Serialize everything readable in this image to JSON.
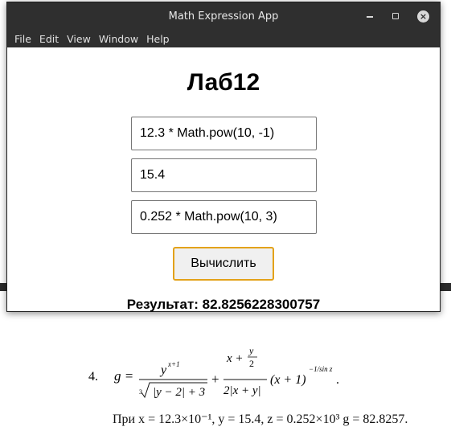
{
  "window": {
    "title": "Math Expression App",
    "controls": {
      "minimize": "minimize",
      "maximize": "maximize",
      "close": "×"
    }
  },
  "menu": [
    "File",
    "Edit",
    "View",
    "Window",
    "Help"
  ],
  "app": {
    "heading": "Лаб12",
    "inputs": [
      "12.3 * Math.pow(10, -1)",
      "15.4",
      "0.252 * Math.pow(10, 3)"
    ],
    "button_label": "Вычислить",
    "result_text": "Результат: 82.8256228300757"
  },
  "document": {
    "number": "4.",
    "formula_lhs": "g =",
    "condition": "При x = 12.3×10⁻¹, y = 15.4, z = 0.252×10³  g = 82.8257."
  },
  "colors": {
    "titlebar": "#2f2f2f",
    "button_border": "#e3a21a"
  }
}
